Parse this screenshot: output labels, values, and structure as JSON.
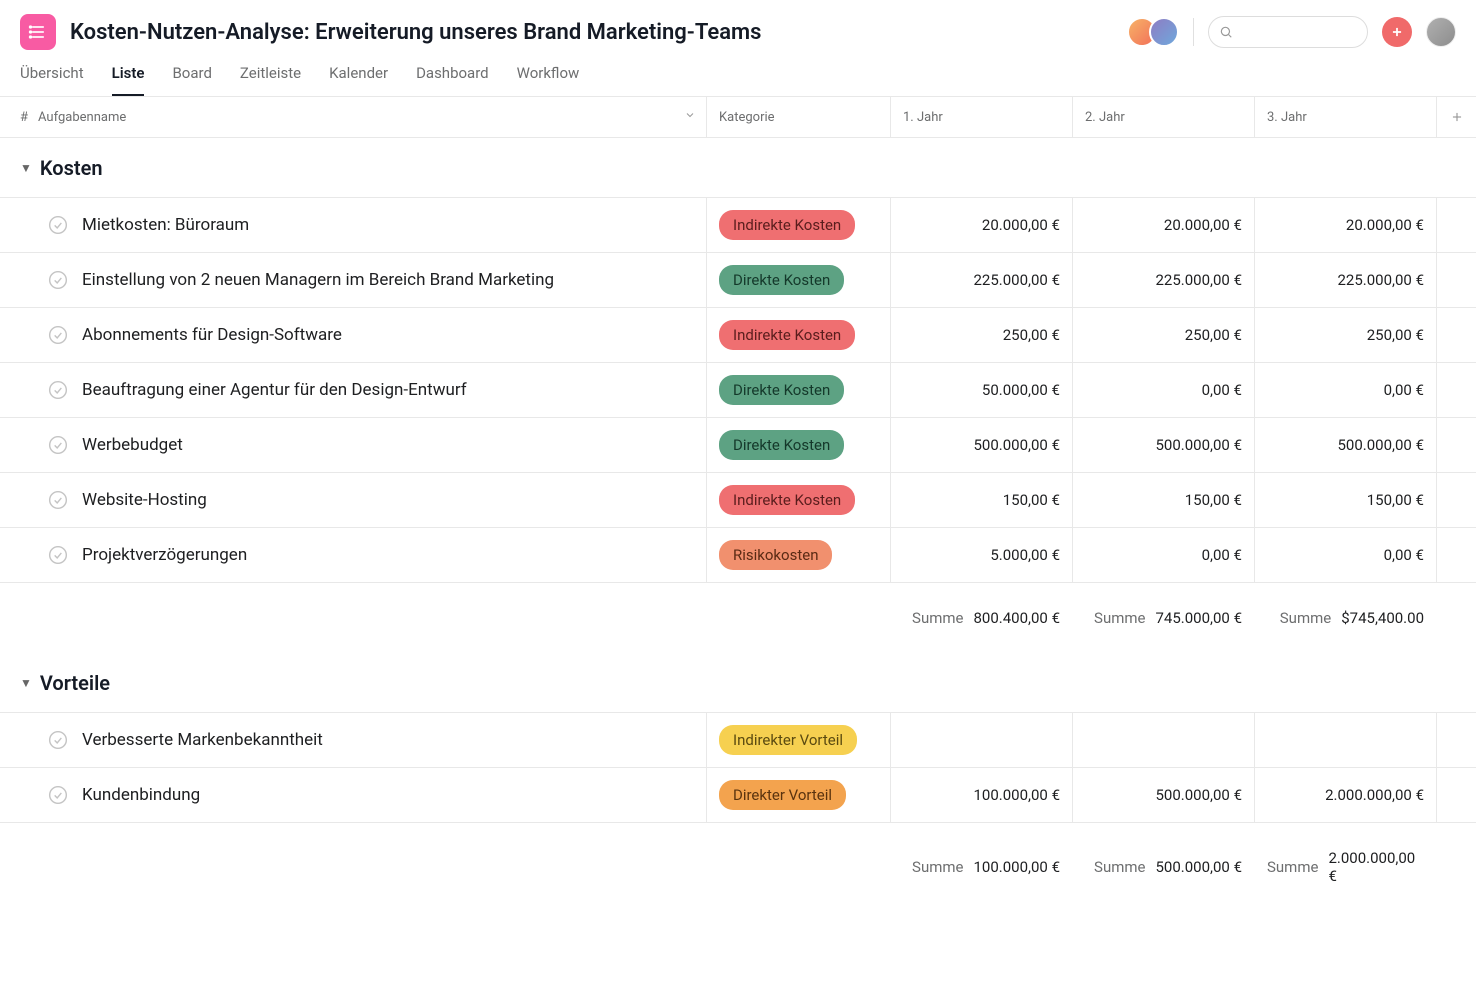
{
  "header": {
    "title": "Kosten-Nutzen-Analyse: Erweiterung unseres Brand Marketing-Teams"
  },
  "tabs": [
    "Übersicht",
    "Liste",
    "Board",
    "Zeitleiste",
    "Kalender",
    "Dashboard",
    "Workflow"
  ],
  "columns": {
    "drag": "#",
    "name": "Aufgabenname",
    "cat": "Kategorie",
    "y1": "1. Jahr",
    "y2": "2. Jahr",
    "y3": "3. Jahr"
  },
  "categories": {
    "indirect_cost": {
      "label": "Indirekte Kosten",
      "bg": "#ef6f71",
      "fg": "#5a1d1d"
    },
    "direct_cost": {
      "label": "Direkte Kosten",
      "bg": "#5da283",
      "fg": "#14382a"
    },
    "risk_cost": {
      "label": "Risikokosten",
      "bg": "#f1906e",
      "fg": "#5a2a14"
    },
    "indirect_ben": {
      "label": "Indirekter Vorteil",
      "bg": "#f6d050",
      "fg": "#5a4a10"
    },
    "direct_ben": {
      "label": "Direkter Vorteil",
      "bg": "#f3a34e",
      "fg": "#5a330e"
    }
  },
  "sections": [
    {
      "title": "Kosten",
      "rows": [
        {
          "name": "Mietkosten: Büroraum",
          "cat": "indirect_cost",
          "y1": "20.000,00 €",
          "y2": "20.000,00 €",
          "y3": "20.000,00 €"
        },
        {
          "name": "Einstellung von 2 neuen Managern im Bereich Brand Marketing",
          "cat": "direct_cost",
          "y1": "225.000,00 €",
          "y2": "225.000,00 €",
          "y3": "225.000,00 €"
        },
        {
          "name": "Abonnements für Design-Software",
          "cat": "indirect_cost",
          "y1": "250,00 €",
          "y2": "250,00 €",
          "y3": "250,00 €"
        },
        {
          "name": "Beauftragung einer Agentur für den Design-Entwurf",
          "cat": "direct_cost",
          "y1": "50.000,00 €",
          "y2": "0,00 €",
          "y3": "0,00 €"
        },
        {
          "name": "Werbebudget",
          "cat": "direct_cost",
          "y1": "500.000,00 €",
          "y2": "500.000,00 €",
          "y3": "500.000,00 €"
        },
        {
          "name": "Website-Hosting",
          "cat": "indirect_cost",
          "y1": "150,00 €",
          "y2": "150,00 €",
          "y3": "150,00 €"
        },
        {
          "name": "Projektverzögerungen",
          "cat": "risk_cost",
          "y1": "5.000,00 €",
          "y2": "0,00 €",
          "y3": "0,00 €"
        }
      ],
      "sum": {
        "label": "Summe",
        "y1": "800.400,00 €",
        "y2": "745.000,00 €",
        "y3": "$745,400.00"
      }
    },
    {
      "title": "Vorteile",
      "rows": [
        {
          "name": "Verbesserte Markenbekanntheit",
          "cat": "indirect_ben",
          "y1": "",
          "y2": "",
          "y3": ""
        },
        {
          "name": "Kundenbindung",
          "cat": "direct_ben",
          "y1": "100.000,00 €",
          "y2": "500.000,00 €",
          "y3": "2.000.000,00 €"
        }
      ],
      "sum": {
        "label": "Summe",
        "y1": "100.000,00 €",
        "y2": "500.000,00 €",
        "y3": "2.000.000,00 €"
      }
    }
  ]
}
